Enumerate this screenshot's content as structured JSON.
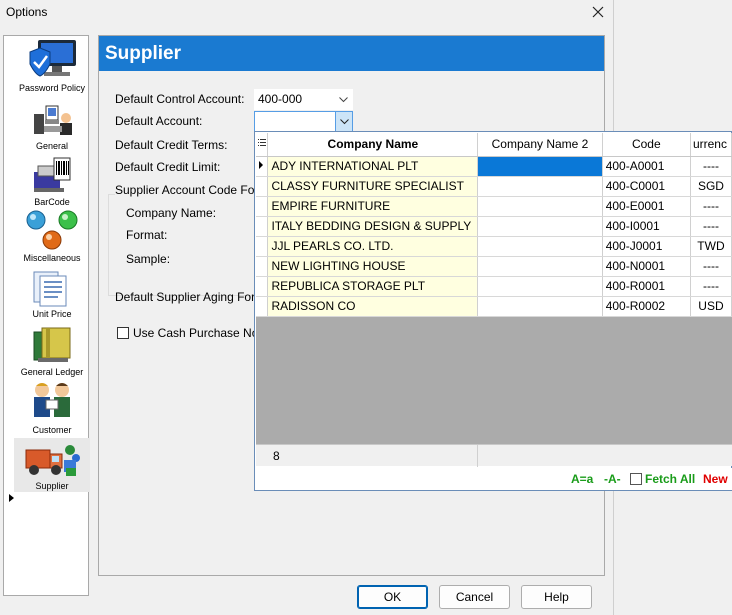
{
  "window": {
    "title": "Options"
  },
  "sidebar": {
    "items": [
      {
        "label": "Password Policy",
        "icon": "password-policy-icon"
      },
      {
        "label": "General",
        "icon": "general-icon"
      },
      {
        "label": "BarCode",
        "icon": "barcode-icon"
      },
      {
        "label": "Miscellaneous",
        "icon": "miscellaneous-icon"
      },
      {
        "label": "Unit Price",
        "icon": "unit-price-icon"
      },
      {
        "label": "General Ledger",
        "icon": "general-ledger-icon"
      },
      {
        "label": "Customer",
        "icon": "customer-icon"
      },
      {
        "label": "Supplier",
        "icon": "supplier-icon"
      }
    ],
    "selected": "Supplier"
  },
  "panel": {
    "header": "Supplier",
    "fields": {
      "control_account_label": "Default Control Account:",
      "control_account_value": "400-000",
      "default_account_label": "Default Account:",
      "default_account_value": "",
      "credit_terms_label": "Default Credit Terms:",
      "credit_limit_label": "Default Credit Limit:",
      "account_code_group_label": "Supplier Account Code Fo",
      "company_name_label": "Company Name:",
      "format_label": "Format:",
      "sample_label": "Sample:",
      "aging_label": "Default Supplier Aging For",
      "cash_purchase_label": "Use Cash Purchase No."
    }
  },
  "lookup": {
    "columns": [
      "Company Name",
      "Company Name 2",
      "Code",
      "urrenc"
    ],
    "rows": [
      {
        "name": "ADY INTERNATIONAL PLT",
        "name2": "",
        "code": "400-A0001",
        "currency": "----"
      },
      {
        "name": "CLASSY FURNITURE SPECIALIST",
        "name2": "",
        "code": "400-C0001",
        "currency": "SGD"
      },
      {
        "name": "EMPIRE FURNITURE",
        "name2": "",
        "code": "400-E0001",
        "currency": "----"
      },
      {
        "name": "ITALY BEDDING DESIGN & SUPPLY",
        "name2": "",
        "code": "400-I0001",
        "currency": "----"
      },
      {
        "name": "JJL PEARLS CO. LTD.",
        "name2": "",
        "code": "400-J0001",
        "currency": "TWD"
      },
      {
        "name": "NEW LIGHTING HOUSE",
        "name2": "",
        "code": "400-N0001",
        "currency": "----"
      },
      {
        "name": "REPUBLICA STORAGE PLT",
        "name2": "",
        "code": "400-R0001",
        "currency": "----"
      },
      {
        "name": "RADISSON CO",
        "name2": "",
        "code": "400-R0002",
        "currency": "USD"
      }
    ],
    "record_count": "8",
    "toolbar": {
      "case_label": "A=a",
      "accent_label": "-A-",
      "fetch_all_label": "Fetch All",
      "fetch_all_checked": false,
      "new_label": "New"
    }
  },
  "buttons": {
    "ok": "OK",
    "cancel": "Cancel",
    "help": "Help"
  },
  "colors": {
    "header_blue": "#1a7ad1",
    "selection_blue": "#0a78d7",
    "name_column_bg": "#ffffe0",
    "link_green": "#1a9c1a",
    "link_red": "#e00000"
  }
}
